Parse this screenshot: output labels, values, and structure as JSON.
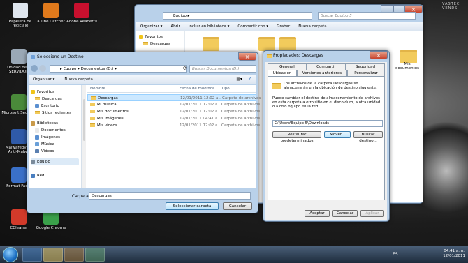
{
  "desktop": {
    "icons": [
      {
        "label": "Papelera de reciclaje",
        "color": "#dfe6ee"
      },
      {
        "label": "aTube Catcher",
        "color": "#e07a1c"
      },
      {
        "label": "Adobe Reader 9",
        "color": "#c8102e"
      },
      {
        "label": "Unidad de R (SERVIDOR)",
        "color": "#9aa8b6"
      },
      {
        "label": "Microsoft Security",
        "color": "#4a8a3a"
      },
      {
        "label": "Malwarebytes Anti-Malwa",
        "color": "#2f5aa8"
      },
      {
        "label": "Format Facto",
        "color": "#3a70c8"
      },
      {
        "label": "CCleaner",
        "color": "#d23a2a"
      },
      {
        "label": "Google Chrome",
        "color": "#3aa04a"
      }
    ],
    "brand": "VASTEC VENDS"
  },
  "explorer": {
    "address": "Equipo ▸",
    "search_placeholder": "Buscar Equipo 5",
    "toolbar": [
      "Organizar ▾",
      "Abrir",
      "Incluir en biblioteca ▾",
      "Compartir con ▾",
      "Grabar",
      "Nueva carpeta"
    ],
    "nav": [
      "Favoritos",
      "Descargas"
    ],
    "side_item": "Mis documentos"
  },
  "dialog": {
    "title": "Seleccione un Destino",
    "address": "▸ Equipo ▸ Documentos (D:) ▸",
    "search_placeholder": "Buscar Documentos (D:)",
    "toolbar": {
      "organize": "Organizar ▾",
      "new_folder": "Nueva carpeta"
    },
    "nav": [
      {
        "label": "Favoritos",
        "kind": "star",
        "indent": 0
      },
      {
        "label": "Descargas",
        "kind": "folder",
        "indent": 1
      },
      {
        "label": "Escritorio",
        "kind": "blue",
        "indent": 1
      },
      {
        "label": "Sitios recientes",
        "kind": "folder",
        "indent": 1
      },
      {
        "label": "",
        "kind": "gap",
        "indent": 0
      },
      {
        "label": "Bibliotecas",
        "kind": "lib",
        "indent": 0
      },
      {
        "label": "Documentos",
        "kind": "doc",
        "indent": 1
      },
      {
        "label": "Imágenes",
        "kind": "blue",
        "indent": 1
      },
      {
        "label": "Música",
        "kind": "music",
        "indent": 1
      },
      {
        "label": "Vídeos",
        "kind": "video",
        "indent": 1
      },
      {
        "label": "",
        "kind": "gap",
        "indent": 0
      },
      {
        "label": "Equipo",
        "kind": "pc",
        "indent": 0
      },
      {
        "label": "",
        "kind": "gap",
        "indent": 0
      },
      {
        "label": "",
        "kind": "gap",
        "indent": 0
      },
      {
        "label": "Red",
        "kind": "net",
        "indent": 0
      }
    ],
    "columns": {
      "name": "Nombre",
      "date": "Fecha de modifica...",
      "type": "Tipo"
    },
    "rows": [
      {
        "name": "Descargas",
        "date": "12/01/2011 12:02 a...",
        "type": "Carpeta de archivos"
      },
      {
        "name": "Mi música",
        "date": "12/01/2011 12:02 a...",
        "type": "Carpeta de archivos"
      },
      {
        "name": "Mis documentos",
        "date": "12/01/2011 12:02 a...",
        "type": "Carpeta de archivos"
      },
      {
        "name": "Mis imágenes",
        "date": "12/01/2011 04:41 a...",
        "type": "Carpeta de archivos"
      },
      {
        "name": "Mis vídeos",
        "date": "12/01/2011 12:02 a...",
        "type": "Carpeta de archivos"
      }
    ],
    "folder_label": "Carpeta:",
    "folder_value": "Descargas",
    "select_button": "Seleccionar carpeta",
    "cancel_button": "Cancelar"
  },
  "properties": {
    "title": "Propiedades: Descargas",
    "tabs_back": [
      "General",
      "Compartir",
      "Seguridad"
    ],
    "tabs_front": [
      "Ubicación",
      "Versiones anteriores",
      "Personalizar"
    ],
    "info": "Los archivos de la carpeta Descargas se almacenarán en la ubicación de destino siguiente.",
    "desc": "Puede cambiar el destino de almacenamiento de archivos en esta carpeta a otro sitio en el disco duro, a otra unidad o a otro equipo en la red.",
    "path": "C:\\Users\\Equipo 5\\Downloads",
    "restore_button": "Restaurar predeterminados",
    "move_button": "Mover...",
    "find_button": "Buscar destino...",
    "ok_button": "Aceptar",
    "cancel_button": "Cancelar",
    "apply_button": "Aplicar"
  },
  "taskbar": {
    "lang": "ES",
    "time": "04:41 a.m.",
    "date": "12/01/2011"
  }
}
